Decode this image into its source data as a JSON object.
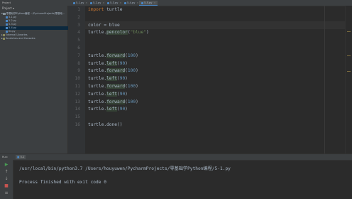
{
  "window": {
    "project_menu": "Project"
  },
  "tabs": [
    {
      "label": "5-1.py"
    },
    {
      "label": "5-2.py"
    },
    {
      "label": "5-3.py"
    },
    {
      "label": "5-4.py"
    },
    {
      "label": "5-5.py"
    }
  ],
  "project_panel": {
    "title": "Project",
    "tree": [
      {
        "label": "零基础学Python编程  ~/PycharmProjects/零基础..."
      },
      {
        "label": "5-1.py"
      },
      {
        "label": "5-2.py"
      },
      {
        "label": "5-3.py"
      },
      {
        "label": "5-4.py"
      },
      {
        "label": "ttt.py"
      },
      {
        "label": "External Libraries"
      },
      {
        "label": "Scratches and Consoles"
      }
    ]
  },
  "editor": {
    "line_numbers": [
      "1",
      "2",
      "3",
      "4",
      "5",
      "6",
      "7",
      "8",
      "9",
      "10",
      "11",
      "12",
      "13",
      "14",
      "15",
      "16"
    ],
    "lines": {
      "l1_kw": "import",
      "l1_rest": " turtle",
      "l3": "color = blue",
      "l4_a": "turtle.",
      "l4_fn": "pencolor",
      "l4_b": "(",
      "l4_str": "\"blue\"",
      "l4_c": ")",
      "fwd": "forward",
      "left": "left",
      "obj": "turtle.",
      "n100": "100",
      "n90": "90",
      "l16_a": "turtle.done()"
    }
  },
  "run_panel": {
    "label": "Run:",
    "tab": "5-1",
    "command": "/usr/local/bin/python3.7 /Users/houyuwen/PycharmProjects/零基础学Python编程/5-1.py",
    "result": "Process finished with exit code 0"
  }
}
